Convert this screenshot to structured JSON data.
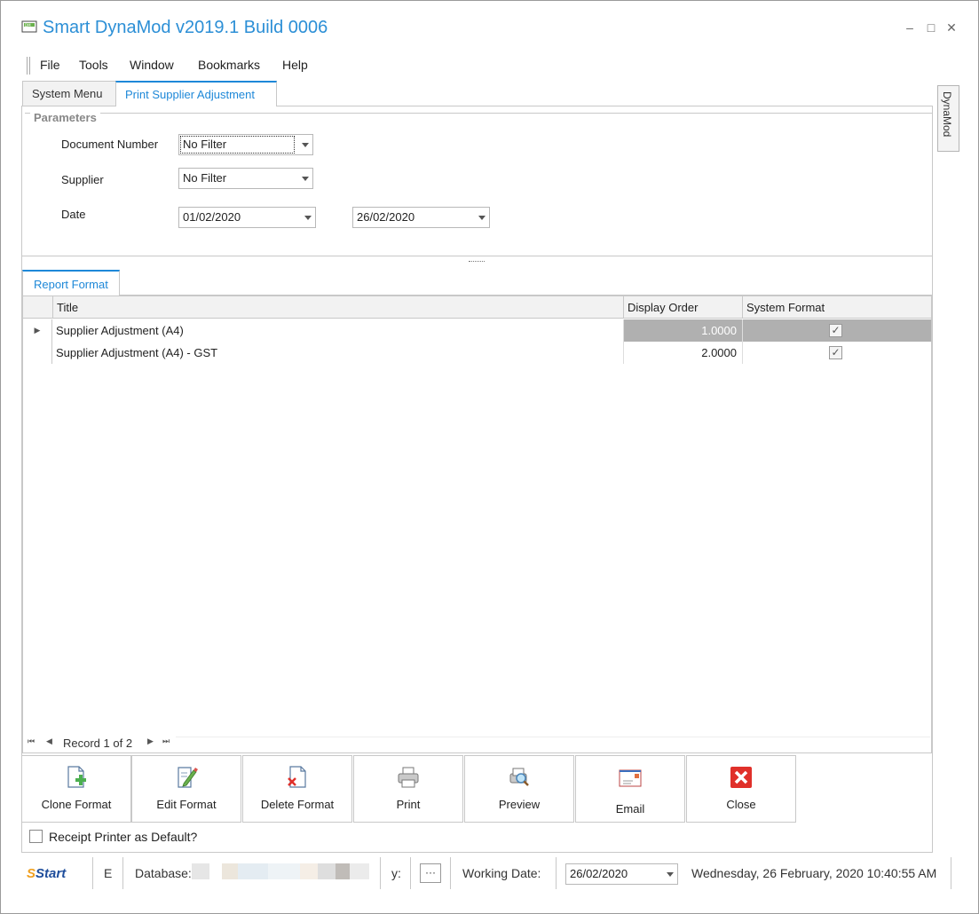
{
  "app": {
    "title": "Smart DynaMod v2019.1 Build 0006",
    "window_controls": {
      "minimize": "–",
      "maximize": "□",
      "close": "✕"
    }
  },
  "menu": [
    "File",
    "Tools",
    "Window",
    "Bookmarks",
    "Help"
  ],
  "tabs": [
    {
      "label": "System Menu",
      "active": false
    },
    {
      "label": "Print Supplier Adjustment",
      "active": true
    }
  ],
  "side_tab": {
    "label": "DynaMod"
  },
  "parameters": {
    "legend": "Parameters",
    "document_number": {
      "label": "Document Number",
      "value": "No Filter"
    },
    "supplier": {
      "label": "Supplier",
      "value": "No Filter"
    },
    "date": {
      "label": "Date",
      "from": "01/02/2020",
      "to": "26/02/2020"
    }
  },
  "report_format": {
    "tab_label": "Report Format",
    "columns": [
      "Title",
      "Display Order",
      "System Format"
    ],
    "rows": [
      {
        "title": "Supplier Adjustment (A4)",
        "display_order": "1.0000",
        "system_format": true,
        "selected": true
      },
      {
        "title": "Supplier Adjustment (A4) - GST",
        "display_order": "2.0000",
        "system_format": true,
        "selected": false
      }
    ],
    "navigator": {
      "record_text": "Record 1 of 2"
    }
  },
  "toolbar": {
    "buttons": [
      {
        "label": "Clone Format",
        "icon": "clone-document-icon"
      },
      {
        "label": "Edit Format",
        "icon": "edit-document-icon"
      },
      {
        "label": "Delete Format",
        "icon": "delete-document-icon"
      },
      {
        "label": "Print",
        "icon": "printer-icon"
      },
      {
        "label": "Preview",
        "icon": "preview-magnifier-icon"
      },
      {
        "label": "Email",
        "icon": "envelope-icon"
      },
      {
        "label": "Close",
        "icon": "close-red-icon"
      }
    ]
  },
  "receipt_printer": {
    "label": "Receipt Printer as Default?",
    "checked": false
  },
  "status_bar": {
    "start_label": "Start",
    "e_label": "E",
    "database_label": "Database:",
    "y_label": "y:",
    "ellipsis": "···",
    "working_date_label": "Working Date:",
    "working_date_value": "26/02/2020",
    "datetime": "Wednesday, 26 February, 2020 10:40:55 AM"
  },
  "colors": {
    "accent": "#1e88d8",
    "title": "#2c8fd6",
    "selected_row": "#b0b0b0",
    "close_red": "#e0302a"
  }
}
